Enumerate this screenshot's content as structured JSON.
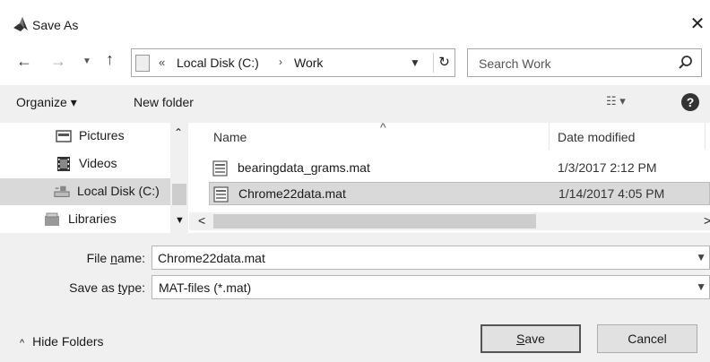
{
  "window": {
    "title": "Save As",
    "close_glyph": "✕"
  },
  "nav": {
    "back_glyph": "←",
    "forward_glyph": "→",
    "recent_glyph": "⌄",
    "up_glyph": "↑",
    "address_overflow": "«",
    "breadcrumbs": [
      "Local Disk (C:)",
      "Work"
    ],
    "crumb_separator": "›",
    "dropdown_glyph": "⌄",
    "refresh_glyph": "↻",
    "search_placeholder": "Search Work"
  },
  "toolbar": {
    "organize_label": "Organize ▾",
    "new_folder_label": "New folder",
    "view_label": "☷ ▾",
    "help_label": "?"
  },
  "sidebar": {
    "items": [
      {
        "label": "Pictures",
        "icon": "pictures-icon"
      },
      {
        "label": "Videos",
        "icon": "videos-icon"
      },
      {
        "label": "Local Disk (C:)",
        "icon": "drive-icon",
        "selected": true
      },
      {
        "label": "Libraries",
        "icon": "libraries-icon"
      }
    ],
    "scroll_up": "⌃",
    "scroll_down": "⌄"
  },
  "file_list": {
    "sort_indicator": "^",
    "columns": [
      "Name",
      "Date modified"
    ],
    "rows": [
      {
        "name": "bearingdata_grams.mat",
        "date": "1/3/2017 2:12 PM",
        "icon": "mat-file-icon"
      },
      {
        "name": "Chrome22data.mat",
        "date": "1/14/2017 4:05 PM",
        "icon": "mat-file-icon",
        "selected": true
      }
    ],
    "scroll_left": "<",
    "scroll_right": ">"
  },
  "form": {
    "filename_label_pre": "File ",
    "filename_label_ul": "n",
    "filename_label_post": "ame:",
    "filename_value": "Chrome22data.mat",
    "savetype_label_pre": "Save as ",
    "savetype_label_ul": "t",
    "savetype_label_post": "ype:",
    "savetype_value": "MAT-files (*.mat)",
    "dropdown_glyph": "⌄"
  },
  "footer": {
    "hide_folders_chevron": "^",
    "hide_folders_label": "Hide Folders",
    "save_ul": "S",
    "save_rest": "ave",
    "cancel_label": "Cancel"
  }
}
